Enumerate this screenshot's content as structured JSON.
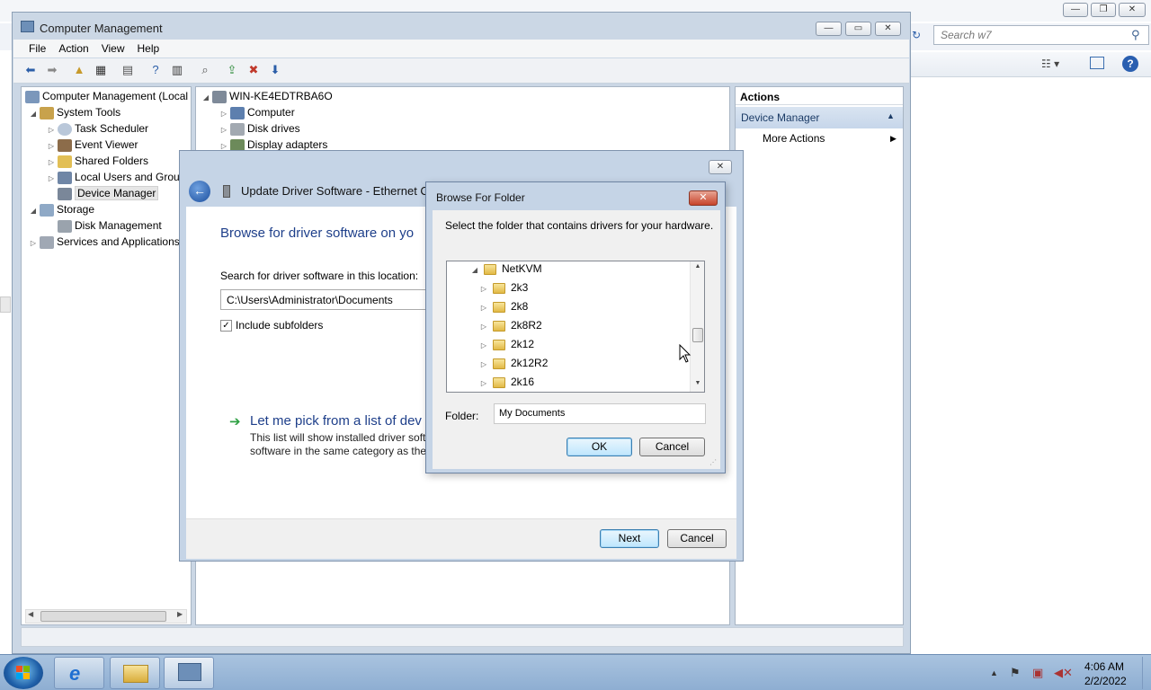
{
  "background_window": {
    "search_placeholder": "Search w7"
  },
  "computer_management": {
    "title": "Computer Management",
    "menu": [
      "File",
      "Action",
      "View",
      "Help"
    ],
    "tree": [
      {
        "label": "Computer Management (Local",
        "icon": "computer-management-icon"
      },
      {
        "label": "System Tools",
        "icon": "tools-icon"
      },
      {
        "label": "Task Scheduler",
        "icon": "clock-icon"
      },
      {
        "label": "Event Viewer",
        "icon": "event-viewer-icon"
      },
      {
        "label": "Shared Folders",
        "icon": "shared-folder-icon"
      },
      {
        "label": "Local Users and Group",
        "icon": "users-icon"
      },
      {
        "label": "Device Manager",
        "icon": "device-manager-icon"
      },
      {
        "label": "Storage",
        "icon": "storage-icon"
      },
      {
        "label": "Disk Management",
        "icon": "disk-icon"
      },
      {
        "label": "Services and Applications",
        "icon": "services-icon"
      }
    ],
    "devices": {
      "root": "WIN-KE4EDTRBA6O",
      "items": [
        "Computer",
        "Disk drives",
        "Display adapters"
      ]
    },
    "actions": {
      "header": "Actions",
      "section": "Device Manager",
      "more": "More Actions"
    }
  },
  "update_driver": {
    "title": "Update Driver Software - Ethernet Cont",
    "heading": "Browse for driver software on yo",
    "search_label": "Search for driver software in this location:",
    "path_value": "C:\\Users\\Administrator\\Documents",
    "include_subfolders_label": "Include subfolders",
    "include_subfolders_checked": true,
    "pick_title": "Let me pick from a list of dev",
    "pick_desc_line1": "This list will show installed driver soft",
    "pick_desc_line2": "software in the same category as the",
    "next_label": "Next",
    "cancel_label": "Cancel"
  },
  "browse_folder": {
    "title": "Browse For Folder",
    "description": "Select the folder that contains drivers for your hardware.",
    "tree": [
      {
        "label": "NetKVM",
        "expanded": true
      },
      {
        "label": "2k3",
        "expanded": false
      },
      {
        "label": "2k8",
        "expanded": false
      },
      {
        "label": "2k8R2",
        "expanded": false
      },
      {
        "label": "2k12",
        "expanded": false
      },
      {
        "label": "2k12R2",
        "expanded": false
      },
      {
        "label": "2k16",
        "expanded": false
      }
    ],
    "folder_label": "Folder:",
    "folder_value": "My Documents",
    "ok_label": "OK",
    "cancel_label": "Cancel"
  },
  "taskbar": {
    "time": "4:06 AM",
    "date": "2/2/2022"
  }
}
